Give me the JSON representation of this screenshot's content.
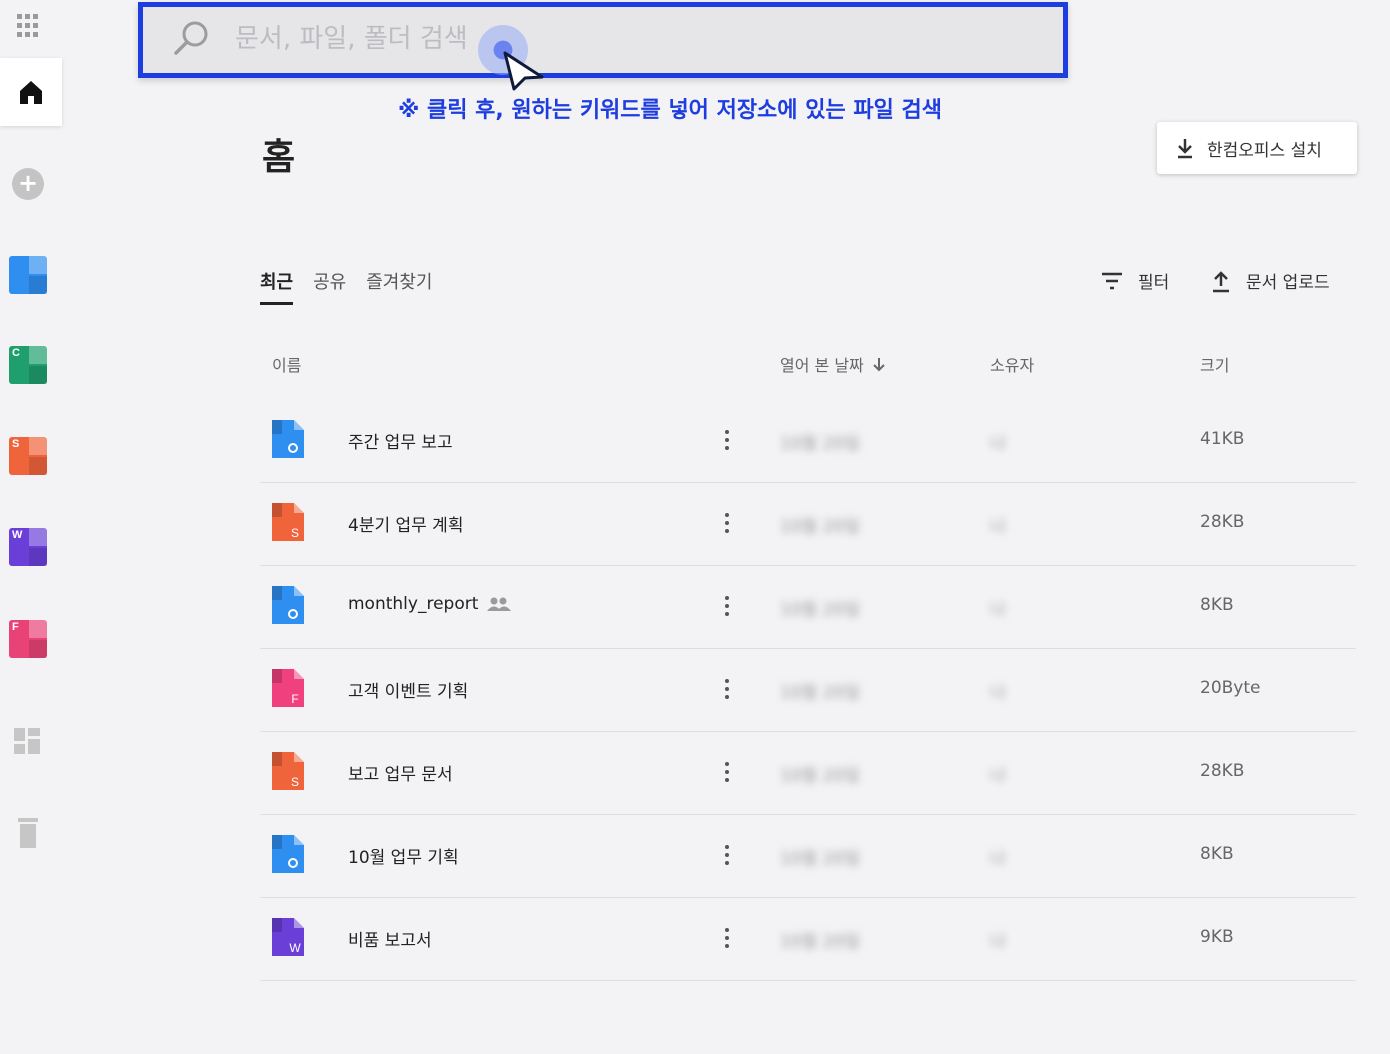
{
  "search": {
    "placeholder": "문서, 파일, 폴더 검색"
  },
  "annotation": {
    "hint": "※ 클릭 후, 원하는 키워드를 넣어 저장소에 있는 파일 검색"
  },
  "page": {
    "title": "홈"
  },
  "install_button": {
    "label": "한컴오피스 설치"
  },
  "tabs": [
    {
      "label": "최근",
      "active": true
    },
    {
      "label": "공유",
      "active": false
    },
    {
      "label": "즐겨찾기",
      "active": false
    }
  ],
  "actions": {
    "filter_label": "필터",
    "upload_label": "문서 업로드"
  },
  "columns": {
    "name": "이름",
    "opened_date": "열어 본 날짜",
    "owner": "소유자",
    "size": "크기"
  },
  "sidebar": {
    "apps": [
      {
        "name": "hwp-app",
        "letter": "",
        "color": "#2e8ff0"
      },
      {
        "name": "cell-app",
        "letter": "C",
        "color": "#1f9e6e"
      },
      {
        "name": "show-app",
        "letter": "S",
        "color": "#f0643c"
      },
      {
        "name": "word-app",
        "letter": "W",
        "color": "#6a3fd8"
      },
      {
        "name": "form-app",
        "letter": "F",
        "color": "#e94277"
      }
    ]
  },
  "files": [
    {
      "name": "주간 업무 보고",
      "type": "hwp",
      "letter": "",
      "color": "#2e8ff0",
      "date": "10월 20일",
      "owner": "나",
      "size": "41KB",
      "shared": false
    },
    {
      "name": "4분기 업무 계획",
      "type": "show",
      "letter": "S",
      "color": "#f0643c",
      "date": "10월 20일",
      "owner": "나",
      "size": "28KB",
      "shared": false
    },
    {
      "name": "monthly_report",
      "type": "hwp",
      "letter": "",
      "color": "#2e8ff0",
      "date": "10월 20일",
      "owner": "나",
      "size": "8KB",
      "shared": true
    },
    {
      "name": "고객 이벤트 기획",
      "type": "form",
      "letter": "F",
      "color": "#f0407e",
      "date": "10월 20일",
      "owner": "나",
      "size": "20Byte",
      "shared": false
    },
    {
      "name": "보고 업무 문서",
      "type": "show",
      "letter": "S",
      "color": "#f0643c",
      "date": "10월 20일",
      "owner": "나",
      "size": "28KB",
      "shared": false
    },
    {
      "name": "10월 업무 기획",
      "type": "hwp",
      "letter": "",
      "color": "#2e8ff0",
      "date": "10월 20일",
      "owner": "나",
      "size": "8KB",
      "shared": false
    },
    {
      "name": "비품 보고서",
      "type": "word",
      "letter": "W",
      "color": "#6a3fd8",
      "date": "10월 20일",
      "owner": "나",
      "size": "9KB",
      "shared": false
    }
  ]
}
